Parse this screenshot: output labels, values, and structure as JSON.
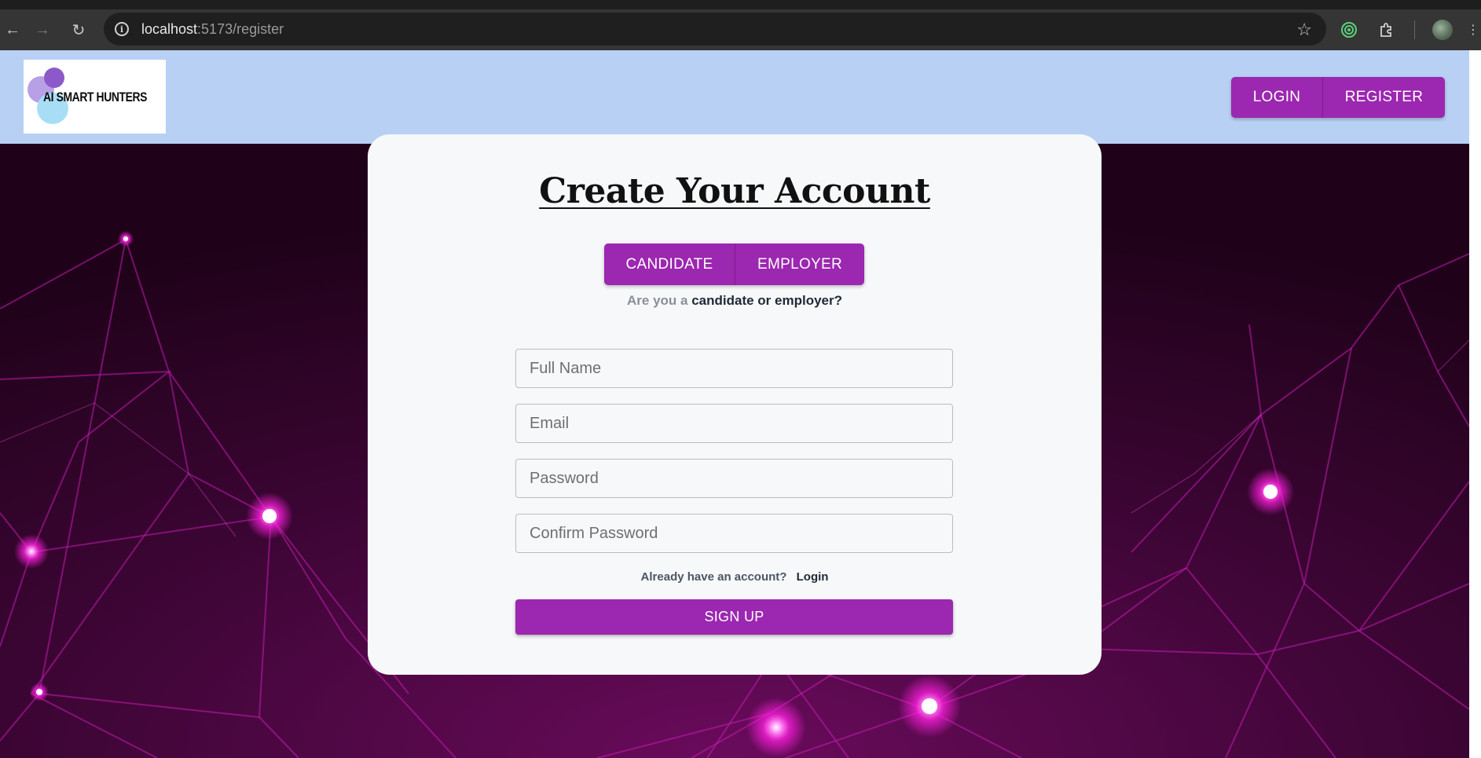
{
  "browser": {
    "url_host": "localhost",
    "url_rest": ":5173/register"
  },
  "header": {
    "logo_text": "AI SMART HUNTERS",
    "login_label": "LOGIN",
    "register_label": "REGISTER"
  },
  "form": {
    "title": "Create Your Account",
    "role_candidate": "CANDIDATE",
    "role_employer": "EMPLOYER",
    "question_prefix": "Are you a",
    "question_emphasis": "candidate or employer?",
    "full_name_placeholder": "Full Name",
    "email_placeholder": "Email",
    "password_placeholder": "Password",
    "confirm_password_placeholder": "Confirm Password",
    "already_text": "Already have an account?",
    "login_link": "Login",
    "signup_label": "SIGN UP"
  },
  "colors": {
    "accent": "#9c27b0",
    "header_bg": "#b8d0f3",
    "card_bg": "#f7f8fa",
    "background_dark": "#2a0624",
    "node_glow": "#ff2ee6"
  }
}
